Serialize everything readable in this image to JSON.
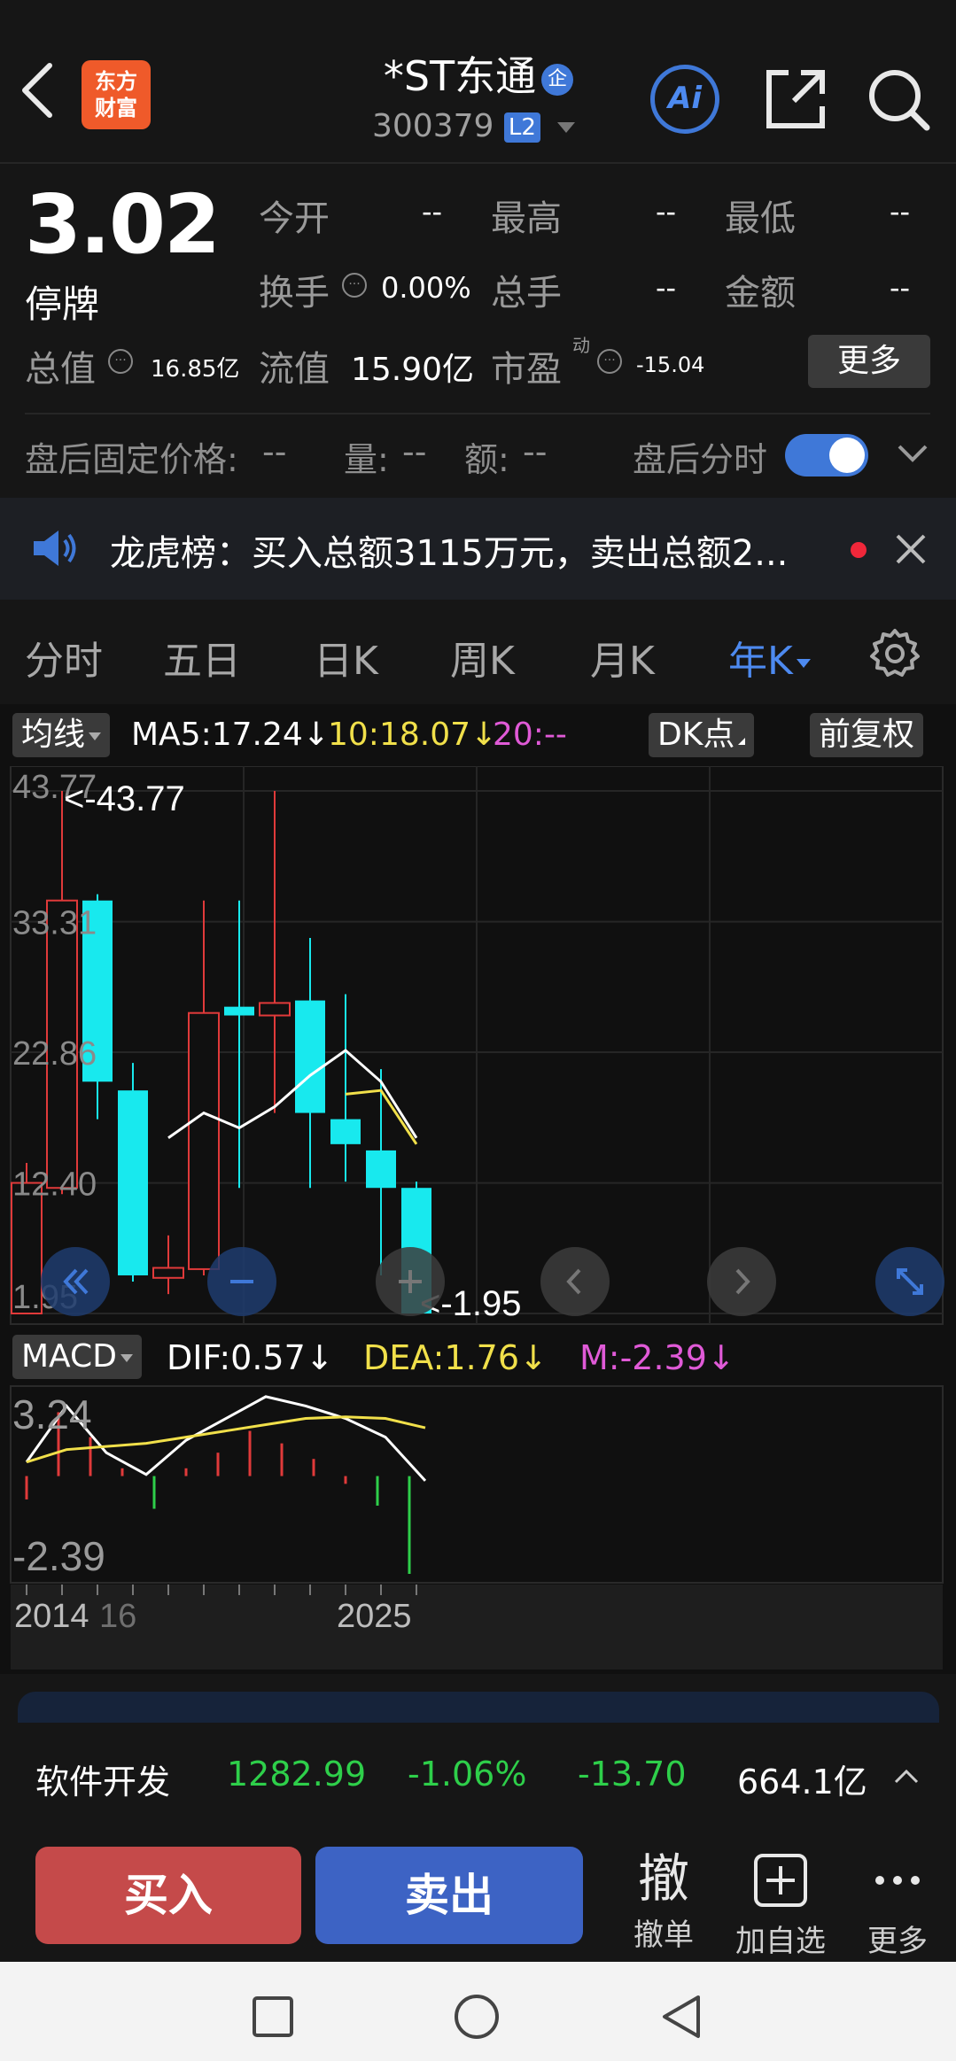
{
  "header": {
    "title": "*ST东通",
    "title_badge": "企",
    "code": "300379",
    "level_badge": "L2",
    "logo_line1": "东方",
    "logo_line2": "财富",
    "ai_label": "Ai"
  },
  "quote": {
    "price": "3.02",
    "status": "停牌",
    "open_label": "今开",
    "open_value": "--",
    "high_label": "最高",
    "high_value": "--",
    "low_label": "最低",
    "low_value": "--",
    "turnover_label": "换手",
    "turnover_value": "0.00%",
    "volume_label": "总手",
    "volume_value": "--",
    "amount_label": "金额",
    "amount_value": "--",
    "mcap_label": "总值",
    "mcap_value": "16.85亿",
    "float_label": "流值",
    "float_value": "15.90亿",
    "pe_label": "市盈",
    "pe_superscript": "动",
    "pe_value": "-15.04",
    "more_label": "更多"
  },
  "after_hours": {
    "price_label": "盘后固定价格:",
    "price_value": "--",
    "vol_label": "量:",
    "vol_value": "--",
    "amt_label": "额:",
    "amt_value": "--",
    "toggle_label": "盘后分时",
    "toggle_on": true
  },
  "notice": {
    "text": "龙虎榜：买入总额3115万元，卖出总额2..."
  },
  "tabs": [
    {
      "label": "分时"
    },
    {
      "label": "五日"
    },
    {
      "label": "日K"
    },
    {
      "label": "周K"
    },
    {
      "label": "月K"
    },
    {
      "label": "年K"
    }
  ],
  "active_tab": "年K",
  "chart_toolbar": {
    "ma_select": "均线",
    "ma5": "MA5:17.24",
    "ma10": "10:18.07",
    "ma20": "20:--",
    "dk_label": "DK点",
    "adjust_label": "前复权",
    "macd_select": "MACD",
    "dif": "DIF:0.57",
    "dea": "DEA:1.76",
    "m": "M:-2.39"
  },
  "chart_data": {
    "type": "candlestick",
    "price_axis_ticks": [
      "43.77",
      "33.31",
      "22.86",
      "12.40",
      "1.95"
    ],
    "price_ylim": [
      1.95,
      43.77
    ],
    "max_marker": "<-43.77",
    "min_marker": "<-1.95",
    "candles": [
      {
        "open": 1.95,
        "close": 12.4,
        "high": 14.0,
        "low": 1.95,
        "dir": "up"
      },
      {
        "open": 12.0,
        "close": 35.0,
        "high": 43.77,
        "low": 11.5,
        "dir": "up"
      },
      {
        "open": 35.0,
        "close": 20.5,
        "high": 35.5,
        "low": 17.5,
        "dir": "down"
      },
      {
        "open": 19.8,
        "close": 5.0,
        "high": 22.0,
        "low": 4.5,
        "dir": "down"
      },
      {
        "open": 4.8,
        "close": 5.6,
        "high": 8.2,
        "low": 3.5,
        "dir": "up"
      },
      {
        "open": 5.5,
        "close": 26.0,
        "high": 35.0,
        "low": 5.0,
        "dir": "up"
      },
      {
        "open": 26.5,
        "close": 25.8,
        "high": 35.0,
        "low": 12.0,
        "dir": "down"
      },
      {
        "open": 25.8,
        "close": 26.8,
        "high": 43.77,
        "low": 18.0,
        "dir": "up"
      },
      {
        "open": 27.0,
        "close": 18.0,
        "high": 32.0,
        "low": 12.0,
        "dir": "down"
      },
      {
        "open": 17.5,
        "close": 15.5,
        "high": 27.5,
        "low": 12.5,
        "dir": "down"
      },
      {
        "open": 15.0,
        "close": 12.0,
        "high": 21.5,
        "low": 5.0,
        "dir": "down"
      },
      {
        "open": 12.0,
        "close": 1.95,
        "high": 12.5,
        "low": 1.95,
        "dir": "down"
      }
    ],
    "ma5_line": [
      null,
      null,
      null,
      null,
      16.0,
      18.0,
      16.8,
      18.5,
      21.0,
      23.0,
      20.5,
      16.0
    ],
    "ma10_line": [
      null,
      null,
      null,
      null,
      null,
      null,
      null,
      null,
      null,
      19.5,
      19.8,
      15.5
    ],
    "macd_axis_ticks": [
      "3.24",
      "-2.39"
    ],
    "macd_ylim": [
      -2.39,
      3.24
    ],
    "dif_line": [
      1.2,
      3.0,
      1.5,
      0.8,
      1.9,
      2.6,
      3.3,
      3.0,
      2.6,
      2.0,
      0.6
    ],
    "dea_line": [
      1.2,
      1.6,
      1.7,
      1.8,
      2.0,
      2.2,
      2.4,
      2.6,
      2.65,
      2.6,
      2.3
    ],
    "macd_bars": [
      0,
      2.8,
      2.0,
      1.0,
      -0.3,
      1.0,
      1.5,
      2.2,
      1.8,
      1.3,
      0.5,
      -0.2,
      -2.39
    ],
    "x_labels": [
      "2014",
      "16",
      "2025"
    ]
  },
  "industry": {
    "name": "软件开发",
    "price": "1282.99",
    "pct": "-1.06%",
    "change": "-13.70",
    "amount": "664.1亿"
  },
  "trade": {
    "buy_label": "买入",
    "sell_label": "卖出",
    "cancel_icon_text": "撤",
    "cancel_label": "撤单",
    "watch_label": "加自选",
    "more_label": "更多"
  },
  "colors": {
    "up": "#e03a3a",
    "down": "#18e9ee",
    "accent": "#4d8af0",
    "ma5": "#ffffff",
    "ma10": "#f1e04a",
    "ma20": "#e05ad7",
    "pos_change": "#2ecf4a"
  }
}
